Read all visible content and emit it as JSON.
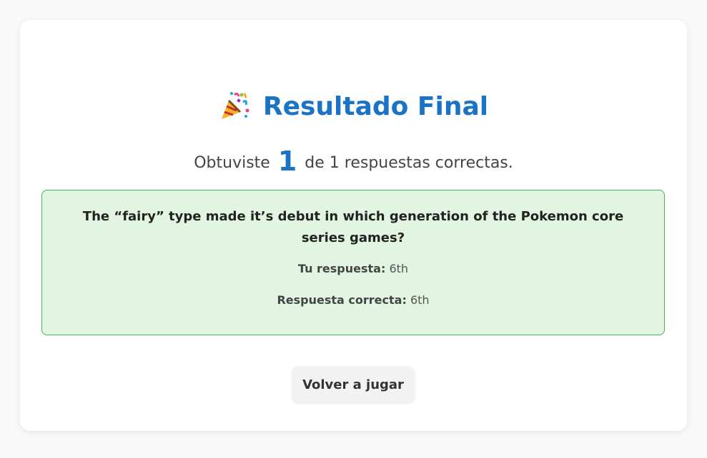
{
  "header": {
    "icon": "party-popper-icon",
    "title": "Resultado Final"
  },
  "score": {
    "prefix": "Obtuviste",
    "correct": "1",
    "suffix": "de 1 respuestas correctas."
  },
  "results": [
    {
      "question": "The “fairy” type made it’s debut in which generation of the Pokemon core series games?",
      "your_answer_label": "Tu respuesta:",
      "your_answer": "6th",
      "correct_answer_label": "Respuesta correcta:",
      "correct_answer": "6th",
      "status": "correct"
    }
  ],
  "actions": {
    "replay_label": "Volver a jugar"
  },
  "colors": {
    "accent": "#1a73c4",
    "correct_bg": "#e2f5e2",
    "correct_border": "#4caf50"
  }
}
